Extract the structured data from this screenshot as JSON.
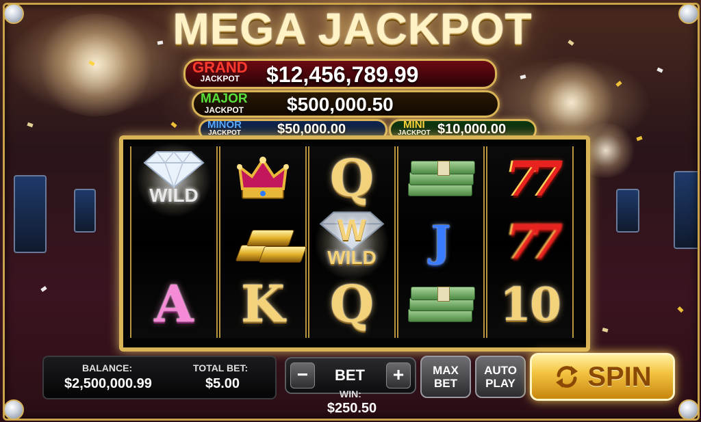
{
  "title": "MEGA JACKPOT",
  "jackpots": {
    "grand": {
      "name": "GRAND",
      "sub": "JACKPOT",
      "value": "$12,456,789.99"
    },
    "major": {
      "name": "MAJOR",
      "sub": "JACKPOT",
      "value": "$500,000.50"
    },
    "minor": {
      "name": "MINOR",
      "sub": "JACKPOT",
      "value": "$50,000.00"
    },
    "mini": {
      "name": "MINI",
      "sub": "JACKPOT",
      "value": "$10,000.00"
    }
  },
  "reels": [
    [
      "diamond-wild",
      "diamond-wild",
      "A"
    ],
    [
      "crown",
      "gold-bars",
      "K"
    ],
    [
      "Q",
      "W-wild",
      "Q"
    ],
    [
      "money",
      "J",
      "money"
    ],
    [
      "77",
      "77",
      "10"
    ]
  ],
  "symbols": {
    "wild_label": "WILD",
    "wild_w": "W",
    "r1c2": "A",
    "r2c2": "K",
    "r3c0": "Q",
    "r3c2": "Q",
    "r4c1": "J",
    "r5c0": "77",
    "r5c1": "77",
    "r5c2": "10"
  },
  "panel": {
    "balance_label": "BALANCE:",
    "balance_value": "$2,500,000.99",
    "total_bet_label": "TOTAL BET:",
    "total_bet_value": "$5.00"
  },
  "bet": {
    "minus": "−",
    "label": "BET",
    "plus": "+"
  },
  "win": {
    "label": "WIN:",
    "value": "$250.50"
  },
  "buttons": {
    "max_bet": [
      "MAX",
      "BET"
    ],
    "auto_play": [
      "AUTO",
      "PLAY"
    ],
    "spin": "SPIN"
  },
  "colors": {
    "gold": "#d9b457",
    "grand": "#ff3a2e",
    "major": "#57e03a",
    "minor": "#55a8ff",
    "mini": "#ffd23a"
  }
}
